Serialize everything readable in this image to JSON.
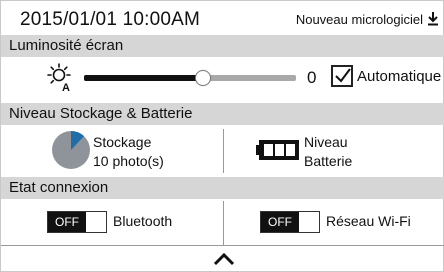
{
  "status": {
    "datetime": "2015/01/01  10:00AM",
    "firmware_label": "Nouveau micrologiciel",
    "firmware_icon": "download-icon"
  },
  "brightness": {
    "header": "Luminosité écran",
    "icon": "auto-brightness-icon",
    "slider_fraction": 0.56,
    "value": "0",
    "auto_checked": true,
    "auto_label": "Automatique"
  },
  "storage": {
    "header": "Niveau Stockage & Batterie",
    "pie_icon": "storage-pie-icon",
    "storage_used_fraction": 0.12,
    "storage_title": "Stockage",
    "storage_count": "10 photo(s)",
    "battery_icon": "battery-icon",
    "battery_level_bars": 3,
    "battery_line1": "Niveau",
    "battery_line2": "Batterie"
  },
  "connection": {
    "header": "Etat connexion",
    "bluetooth": {
      "toggle_text": "OFF",
      "label": "Bluetooth"
    },
    "wifi": {
      "toggle_text": "OFF",
      "label": "Réseau Wi-Fi"
    }
  },
  "footer": {
    "collapse_icon": "chevron-up-icon"
  },
  "colors": {
    "header_bg": "#d6d6d6",
    "accent_blue": "#1f6ea8",
    "pie_gray": "#8f949a",
    "track_gray": "#a9a9a9"
  }
}
